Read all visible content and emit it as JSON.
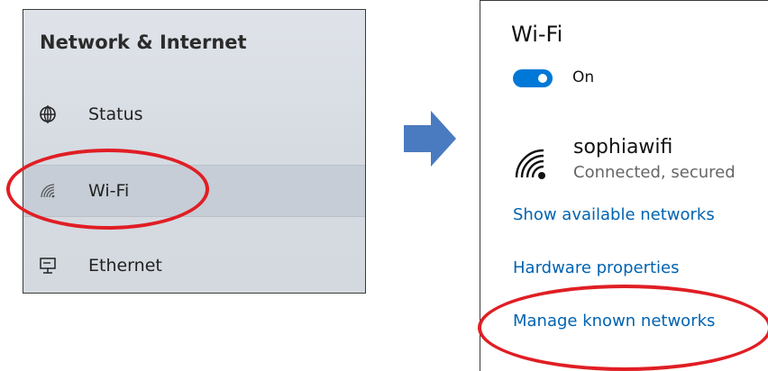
{
  "left_panel": {
    "title": "Network & Internet",
    "items": [
      {
        "label": "Status",
        "icon": "globe-icon"
      },
      {
        "label": "Wi-Fi",
        "icon": "wifi-icon"
      },
      {
        "label": "Ethernet",
        "icon": "ethernet-icon"
      }
    ],
    "selected_index": 1
  },
  "right_panel": {
    "title": "Wi-Fi",
    "toggle_label": "On",
    "toggle_on": true,
    "network_name": "sophiawifi",
    "network_status": "Connected, secured",
    "links": [
      "Show available networks",
      "Hardware properties",
      "Manage known networks"
    ]
  },
  "colors": {
    "accent": "#0078d7",
    "link": "#0063b1",
    "highlight": "#e01e24",
    "arrow": "#4a7bc0"
  }
}
